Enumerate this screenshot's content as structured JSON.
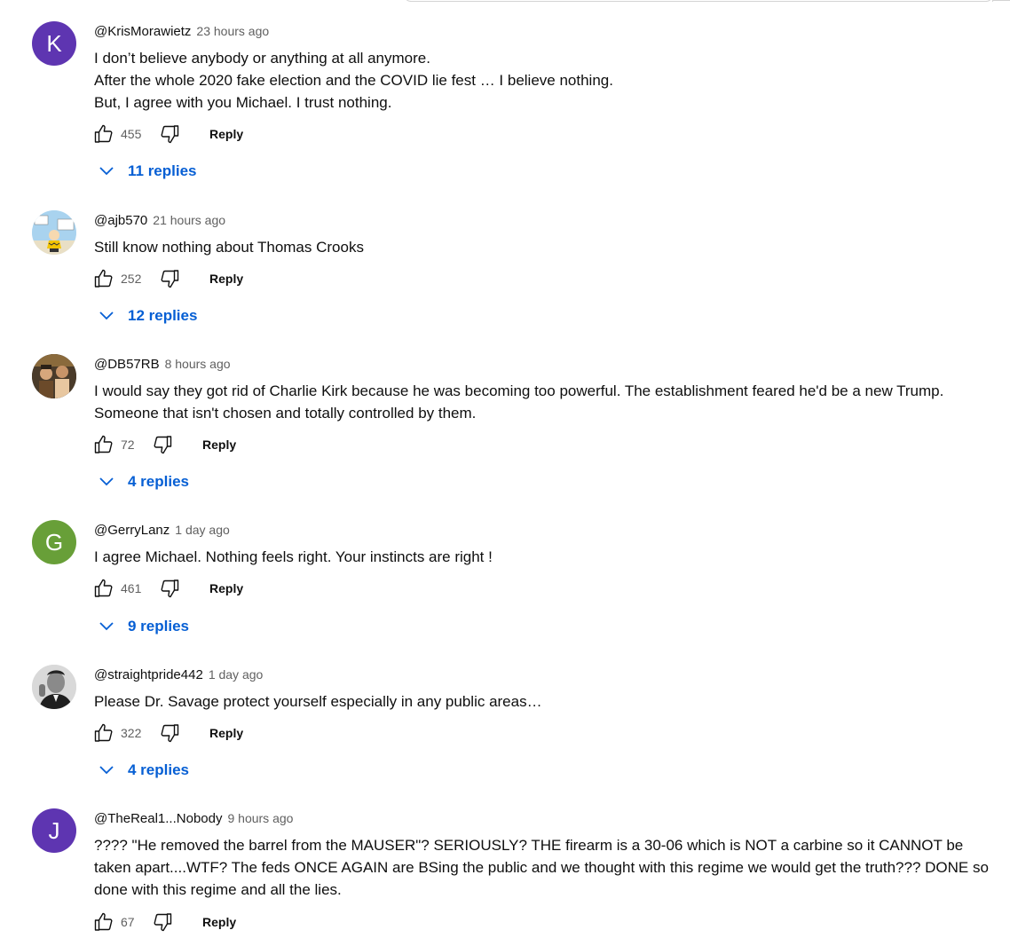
{
  "action_labels": {
    "like_icon": "thumbs-up-icon",
    "dislike_icon": "thumbs-down-icon",
    "reply": "Reply",
    "expand_icon": "chevron-down-icon"
  },
  "colors": {
    "link_blue": "#065fd4",
    "meta_gray": "#606060",
    "text": "#0f0f0f"
  },
  "comments": [
    {
      "author": "@KrisMorawietz",
      "time": "23 hours ago",
      "avatar_letter": "K",
      "avatar_color": "#5e35b1",
      "text": "I don’t believe anybody or anything at all anymore.\nAfter the whole 2020 fake election and the COVID lie fest … I believe nothing.\nBut, I agree with you Michael.  I trust nothing.",
      "likes": "455",
      "replies": "11 replies"
    },
    {
      "author": "@ajb570",
      "time": "21 hours ago",
      "avatar_letter": "",
      "avatar_image": "cartoon-avatar",
      "text": "Still know nothing about Thomas Crooks",
      "likes": "252",
      "replies": "12 replies"
    },
    {
      "author": "@DB57RB",
      "time": "8 hours ago",
      "avatar_letter": "",
      "avatar_image": "photo-avatar",
      "text": "I would say they got rid of Charlie Kirk because he was becoming too powerful. The establishment feared he'd be a new Trump. Someone that isn't chosen and totally controlled by them.",
      "likes": "72",
      "replies": "4 replies"
    },
    {
      "author": "@GerryLanz",
      "time": "1 day ago",
      "avatar_letter": "G",
      "avatar_color": "#689f38",
      "text": "I agree Michael. Nothing feels right. Your instincts are right !",
      "likes": "461",
      "replies": "9 replies"
    },
    {
      "author": "@straightpride442",
      "time": "1 day ago",
      "avatar_letter": "",
      "avatar_image": "portrait-avatar",
      "text": "Please Dr. Savage protect yourself especially in any public areas…",
      "likes": "322",
      "replies": "4 replies"
    },
    {
      "author": "@TheReal1...Nobody",
      "time": "9 hours ago",
      "avatar_letter": "J",
      "avatar_color": "#5e35b1",
      "text": "???? \"He removed the barrel from the MAUSER\"? SERIOUSLY? THE firearm is a 30-06 which is NOT a carbine so it CANNOT be taken apart....WTF? The feds ONCE AGAIN are BSing the public and we thought with this regime we would get the truth??? DONE so done with this regime and all the lies.",
      "likes": "67",
      "replies": ""
    }
  ]
}
